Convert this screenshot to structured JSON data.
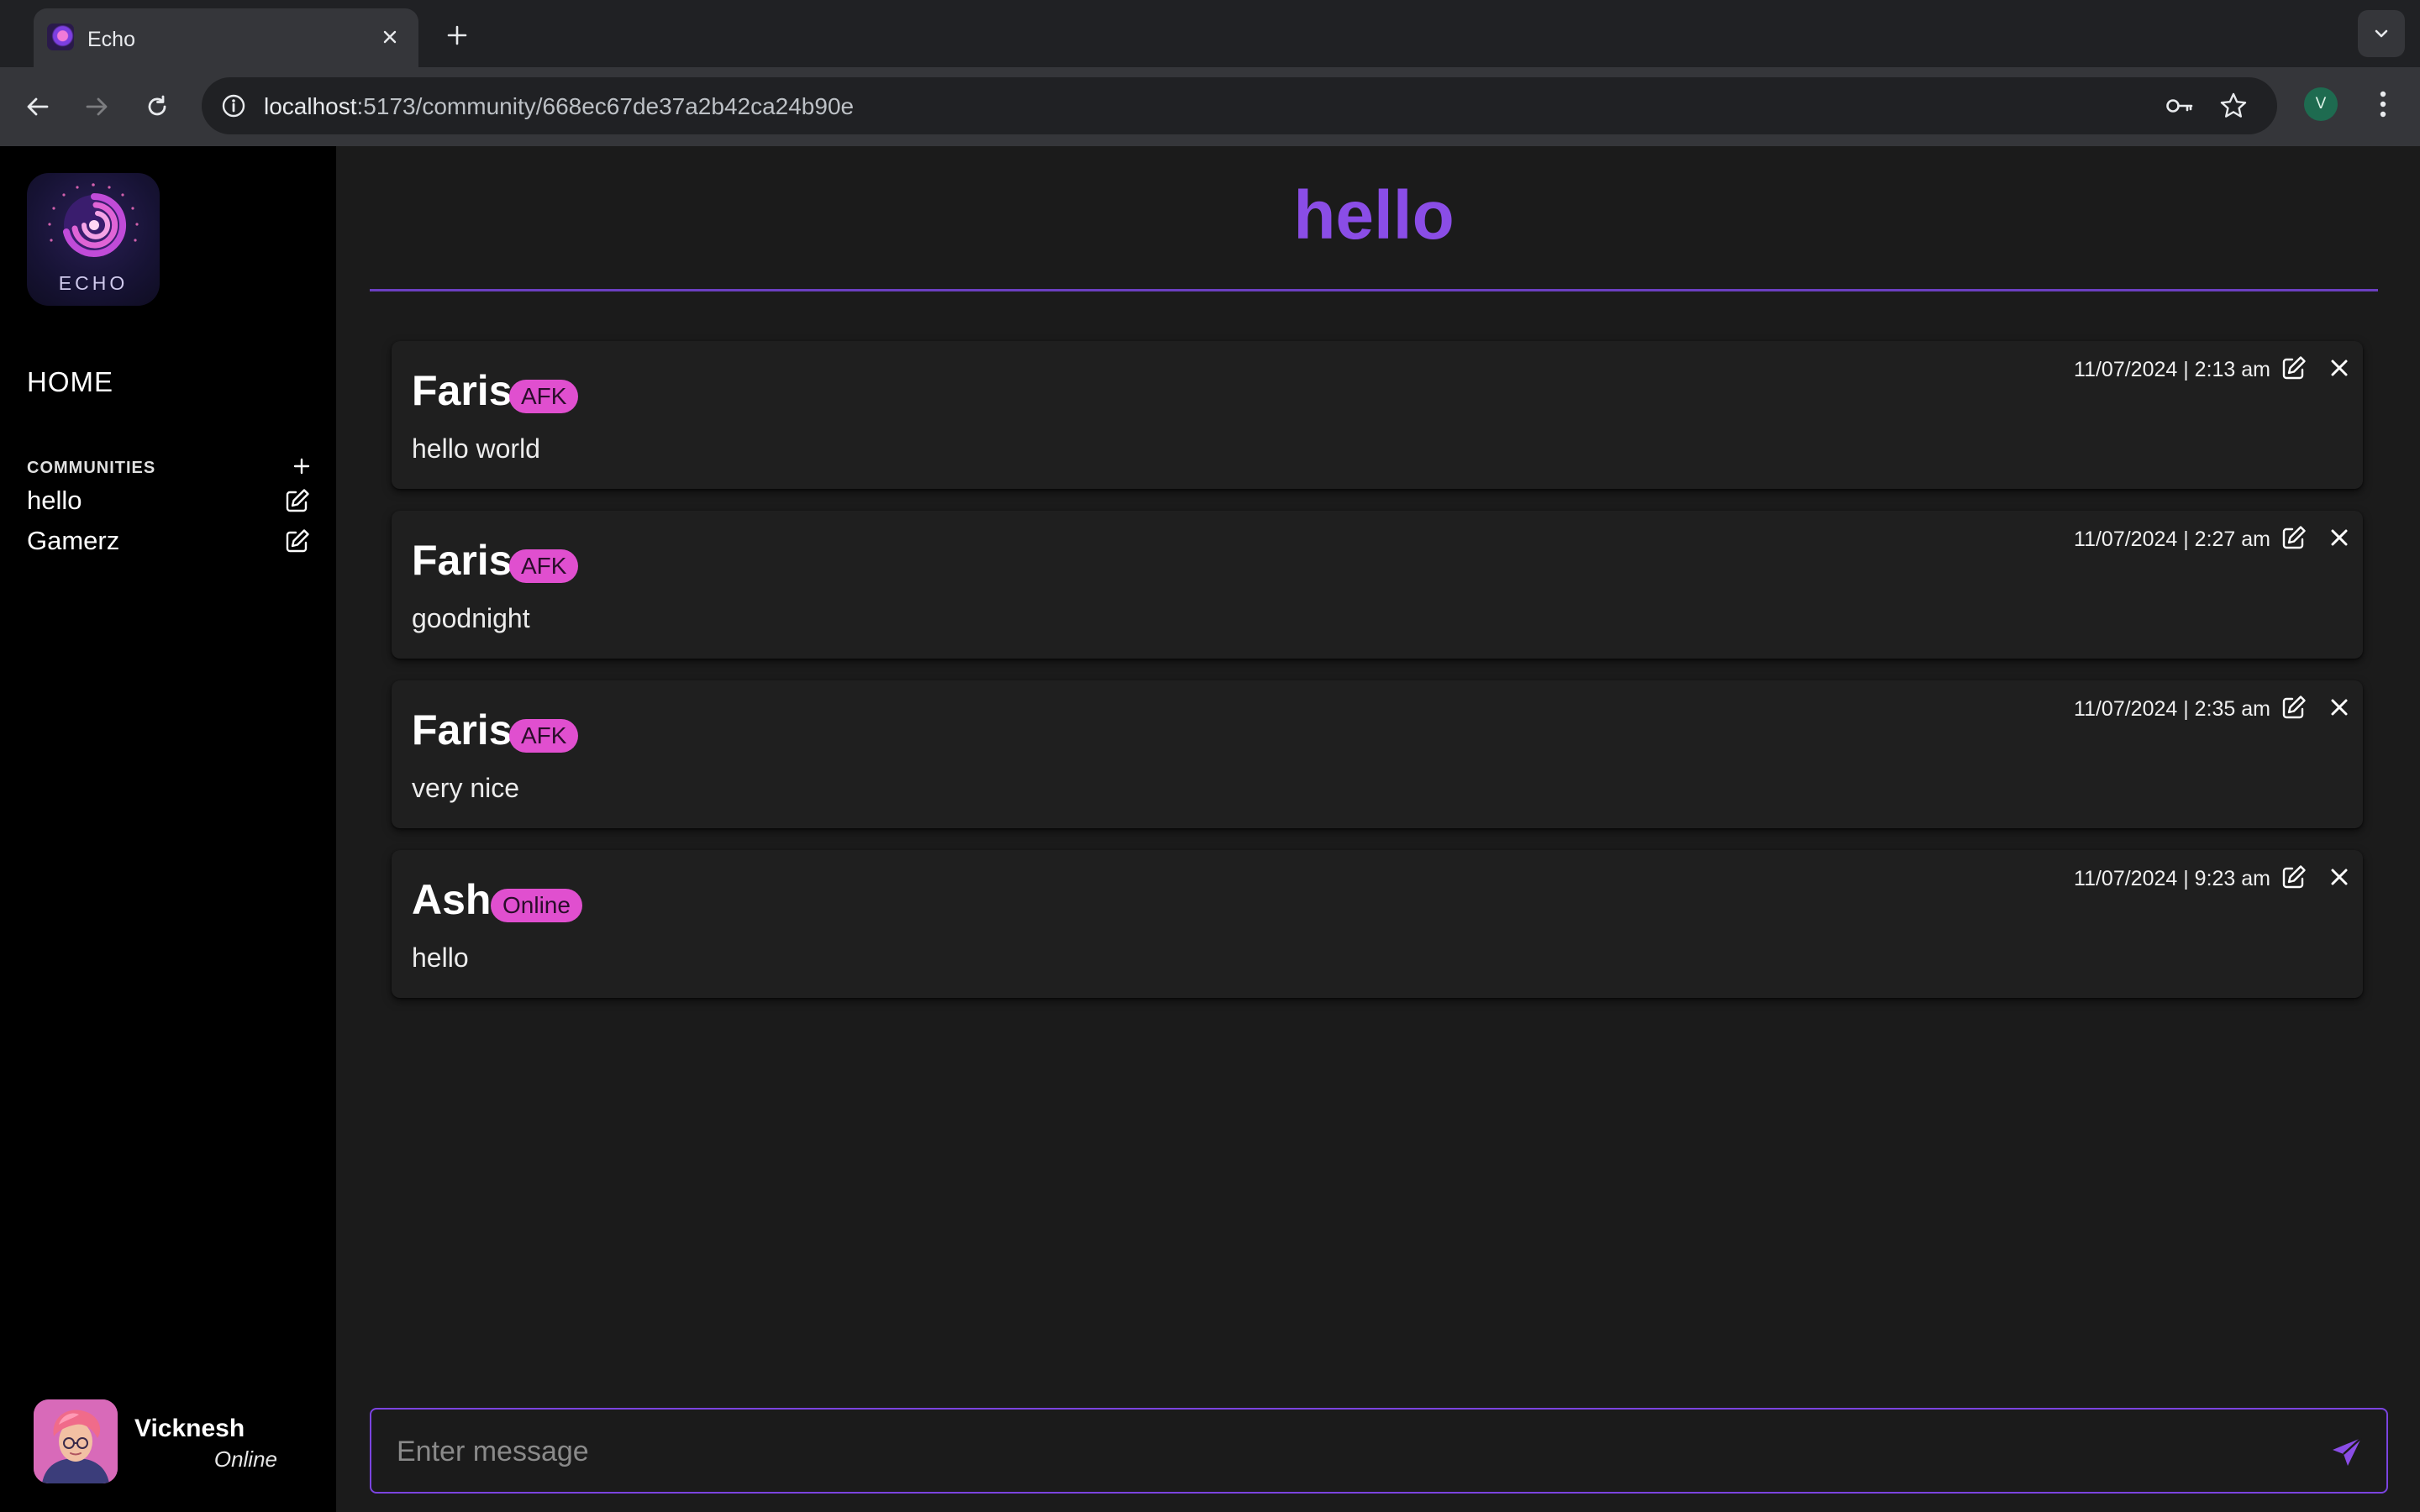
{
  "browser": {
    "tab_title": "Echo",
    "url_host": "localhost",
    "url_path": ":5173/community/668ec67de37a2b42ca24b90e",
    "profile_initial": "V"
  },
  "sidebar": {
    "logo_text": "ECHO",
    "home_label": "HOME",
    "communities_header": "COMMUNITIES",
    "communities": [
      {
        "name": "hello"
      },
      {
        "name": "Gamerz"
      }
    ],
    "user": {
      "name": "Vicknesh",
      "status": "Online"
    }
  },
  "main": {
    "title": "hello",
    "messages": [
      {
        "author": "Faris",
        "badge": "AFK",
        "text": "hello world",
        "time": "11/07/2024 | 2:13 am"
      },
      {
        "author": "Faris",
        "badge": "AFK",
        "text": "goodnight",
        "time": "11/07/2024 | 2:27 am"
      },
      {
        "author": "Faris",
        "badge": "AFK",
        "text": "very nice",
        "time": "11/07/2024 | 2:35 am"
      },
      {
        "author": "Ash",
        "badge": "Online",
        "text": "hello",
        "time": "11/07/2024 | 9:23 am"
      }
    ],
    "composer_placeholder": "Enter message"
  },
  "colors": {
    "accent": "#8a4de6",
    "badge": "#e04fcf",
    "sidebar_bg": "#000000",
    "main_bg": "#1b1b1b"
  }
}
